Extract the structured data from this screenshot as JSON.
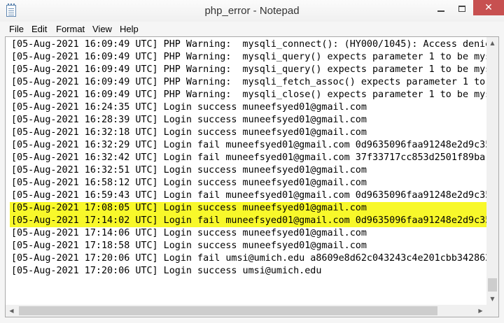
{
  "window": {
    "title": "php_error - Notepad",
    "icon": "notepad-icon",
    "minimize_glyph": "",
    "maximize_glyph": "",
    "close_glyph": "✕",
    "close_color": "#c75050"
  },
  "menu": [
    "File",
    "Edit",
    "Format",
    "View",
    "Help"
  ],
  "editor": {
    "highlight_color": "#f8f82a",
    "lines": [
      "[05-Aug-2021 16:09:49 UTC] PHP Warning:  mysqli_connect(): (HY000/1045): Access denie",
      "[05-Aug-2021 16:09:49 UTC] PHP Warning:  mysqli_query() expects parameter 1 to be mys",
      "[05-Aug-2021 16:09:49 UTC] PHP Warning:  mysqli_query() expects parameter 1 to be mys",
      "[05-Aug-2021 16:09:49 UTC] PHP Warning:  mysqli_fetch_assoc() expects parameter 1 to",
      "[05-Aug-2021 16:09:49 UTC] PHP Warning:  mysqli_close() expects parameter 1 to be mys",
      "[05-Aug-2021 16:24:35 UTC] Login success muneefsyed01@gmail.com",
      "[05-Aug-2021 16:28:39 UTC] Login success muneefsyed01@gmail.com",
      "[05-Aug-2021 16:32:18 UTC] Login success muneefsyed01@gmail.com",
      "[05-Aug-2021 16:32:29 UTC] Login fail muneefsyed01@gmail.com 0d9635096faa91248e2d9c35",
      "[05-Aug-2021 16:32:42 UTC] Login fail muneefsyed01@gmail.com 37f33717cc853d2501f89ba",
      "[05-Aug-2021 16:32:51 UTC] Login success muneefsyed01@gmail.com",
      "[05-Aug-2021 16:58:12 UTC] Login success muneefsyed01@gmail.com",
      "[05-Aug-2021 16:59:43 UTC] Login fail muneefsyed01@gmail.com 0d9635096faa91248e2d9c35",
      "[05-Aug-2021 17:08:05 UTC] Login success muneefsyed01@gmail.com",
      "[05-Aug-2021 17:14:02 UTC] Login fail muneefsyed01@gmail.com 0d9635096faa91248e2d9c35",
      "[05-Aug-2021 17:14:06 UTC] Login success muneefsyed01@gmail.com",
      "[05-Aug-2021 17:18:58 UTC] Login success muneefsyed01@gmail.com",
      "[05-Aug-2021 17:20:06 UTC] Login fail umsi@umich.edu a8609e8d62c043243c4e201cbb342862",
      "[05-Aug-2021 17:20:06 UTC] Login success umsi@umich.edu"
    ],
    "highlighted_lines": [
      13,
      14
    ]
  },
  "scrollbars": {
    "up_arrow": "▲",
    "down_arrow": "▼",
    "left_arrow": "◀",
    "right_arrow": "▶"
  }
}
